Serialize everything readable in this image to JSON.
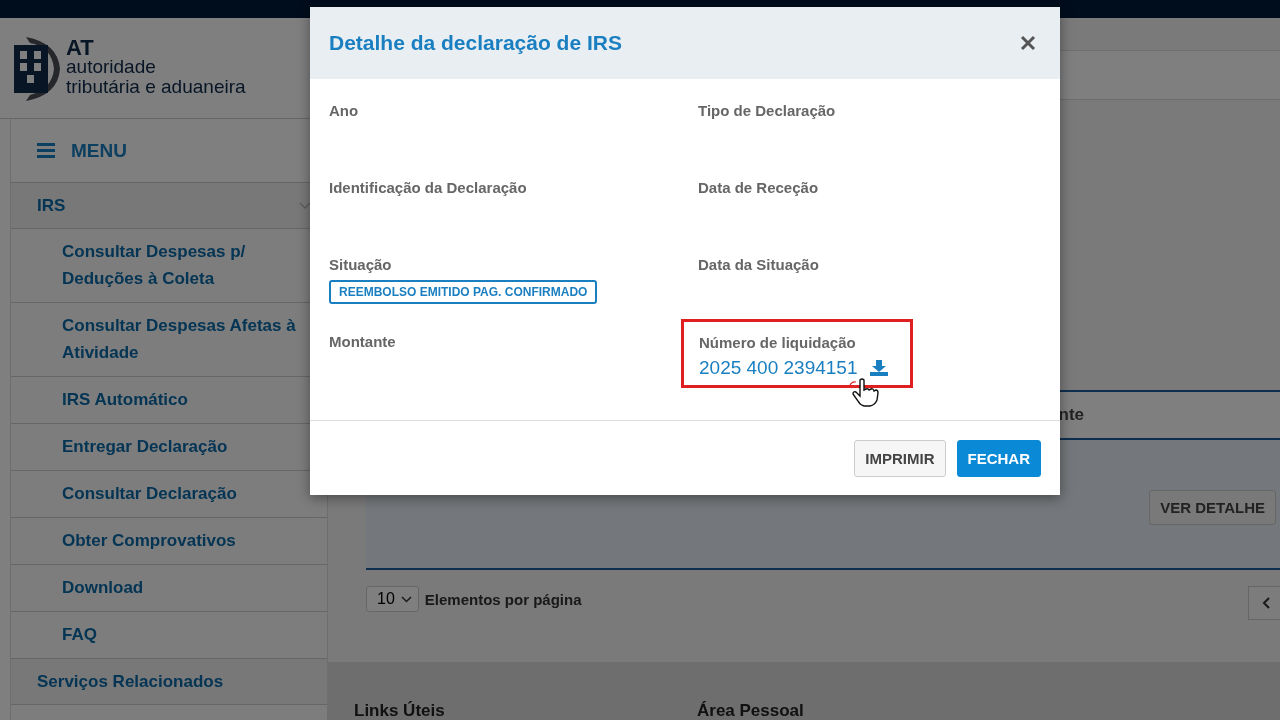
{
  "logo": {
    "abbr": "AT",
    "line1": "autoridade",
    "line2": "tributária e aduaneira"
  },
  "sidebar": {
    "menu_label": "MENU",
    "items": [
      {
        "label": "IRS",
        "children": [
          {
            "label": "Consultar Despesas p/ Deduções à Coleta"
          },
          {
            "label": "Consultar Despesas Afetas à Atividade"
          },
          {
            "label": "IRS Automático"
          },
          {
            "label": "Entregar Declaração"
          },
          {
            "label": "Consultar Declaração"
          },
          {
            "label": "Obter Comprovativos"
          },
          {
            "label": "Download"
          },
          {
            "label": "FAQ"
          }
        ]
      },
      {
        "label": "Serviços Relacionados"
      }
    ]
  },
  "background_page": {
    "table_header": "nte",
    "row_button": "VER DETALHE",
    "page_size": "10",
    "page_size_label": "Elementos por página",
    "footer_headings": [
      "Links Úteis",
      "Área Pessoal"
    ]
  },
  "dialog": {
    "title": "Detalhe da declaração de IRS",
    "fields": [
      {
        "label": "Ano"
      },
      {
        "label": "Tipo de Declaração"
      },
      {
        "label": "Identificação da Declaração"
      },
      {
        "label": "Data de Receção"
      },
      {
        "label": "Situação",
        "badge": "REEMBOLSO EMITIDO PAG. CONFIRMADO"
      },
      {
        "label": "Data da Situação"
      },
      {
        "label": "Montante"
      },
      {
        "label": "Número de liquidação",
        "link": "2025 400 2394151",
        "highlighted": true
      }
    ],
    "buttons": [
      {
        "label": "IMPRIMIR",
        "kind": "secondary"
      },
      {
        "label": "FECHAR",
        "kind": "primary"
      }
    ]
  }
}
